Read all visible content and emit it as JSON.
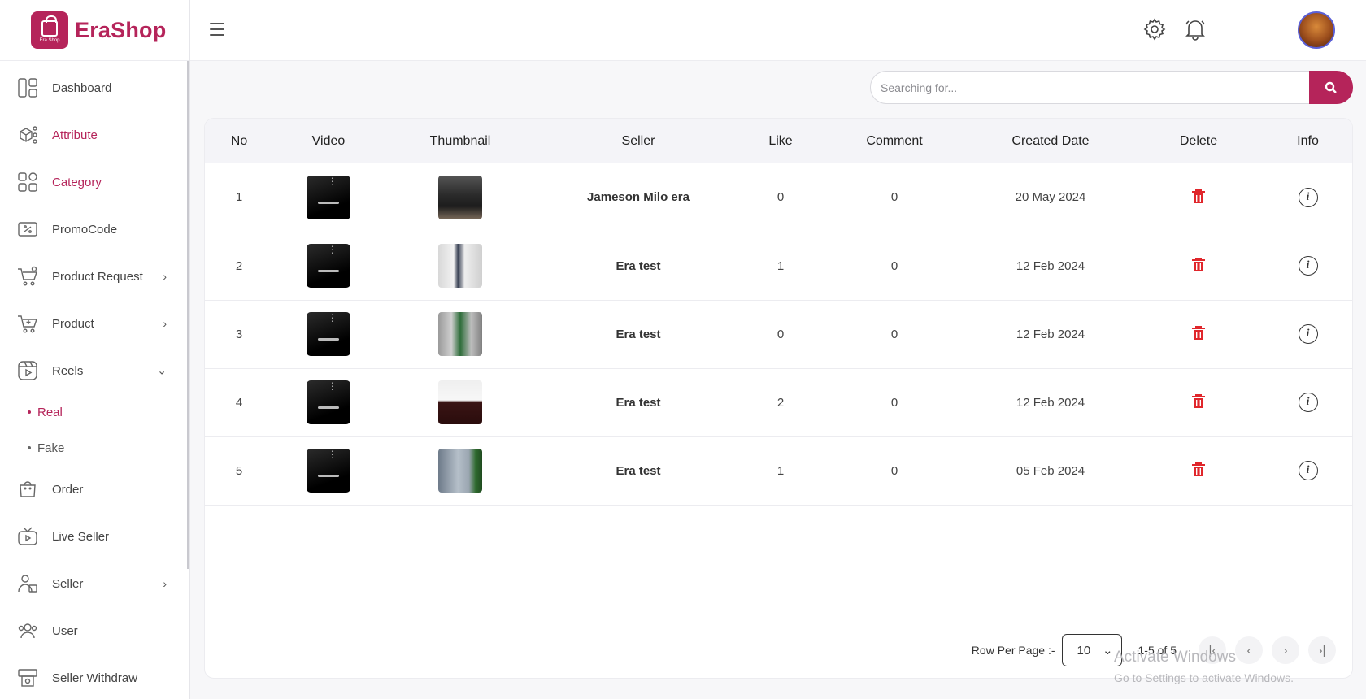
{
  "brand": {
    "name": "EraShop",
    "logo_sub": "Era Shop",
    "accent": "#b5245a"
  },
  "sidebar": {
    "items": [
      {
        "label": "Dashboard",
        "icon": "dashboard-icon"
      },
      {
        "label": "Attribute",
        "icon": "attribute-icon"
      },
      {
        "label": "Category",
        "icon": "category-icon"
      },
      {
        "label": "PromoCode",
        "icon": "promocode-icon"
      },
      {
        "label": "Product Request",
        "icon": "cart-request-icon",
        "chevron": ">"
      },
      {
        "label": "Product",
        "icon": "cart-icon",
        "chevron": ">"
      },
      {
        "label": "Reels",
        "icon": "reels-icon",
        "chevron": "v"
      },
      {
        "label": "Order",
        "icon": "bag-icon"
      },
      {
        "label": "Live Seller",
        "icon": "tv-icon"
      },
      {
        "label": "Seller",
        "icon": "seller-icon",
        "chevron": ">"
      },
      {
        "label": "User",
        "icon": "users-icon"
      },
      {
        "label": "Seller Withdraw",
        "icon": "withdraw-icon"
      }
    ],
    "reels_sub": [
      {
        "label": "Real"
      },
      {
        "label": "Fake"
      }
    ]
  },
  "header": {
    "settings_icon": "gear-icon",
    "notification_icon": "bell-icon"
  },
  "search": {
    "placeholder": "Searching for..."
  },
  "table": {
    "columns": [
      "No",
      "Video",
      "Thumbnail",
      "Seller",
      "Like",
      "Comment",
      "Created Date",
      "Delete",
      "Info"
    ],
    "rows": [
      {
        "no": "1",
        "seller": "Jameson Milo era",
        "like": "0",
        "comment": "0",
        "date": "20 May 2024"
      },
      {
        "no": "2",
        "seller": "Era test",
        "like": "1",
        "comment": "0",
        "date": "12 Feb 2024"
      },
      {
        "no": "3",
        "seller": "Era test",
        "like": "0",
        "comment": "0",
        "date": "12 Feb 2024"
      },
      {
        "no": "4",
        "seller": "Era test",
        "like": "2",
        "comment": "0",
        "date": "12 Feb 2024"
      },
      {
        "no": "5",
        "seller": "Era test",
        "like": "1",
        "comment": "0",
        "date": "05 Feb 2024"
      }
    ]
  },
  "pagination": {
    "rows_label": "Row Per Page :-",
    "rows_value": "10",
    "range": "1-5 of 5"
  },
  "watermark": {
    "line1": "Activate Windows",
    "line2": "Go to Settings to activate Windows."
  }
}
